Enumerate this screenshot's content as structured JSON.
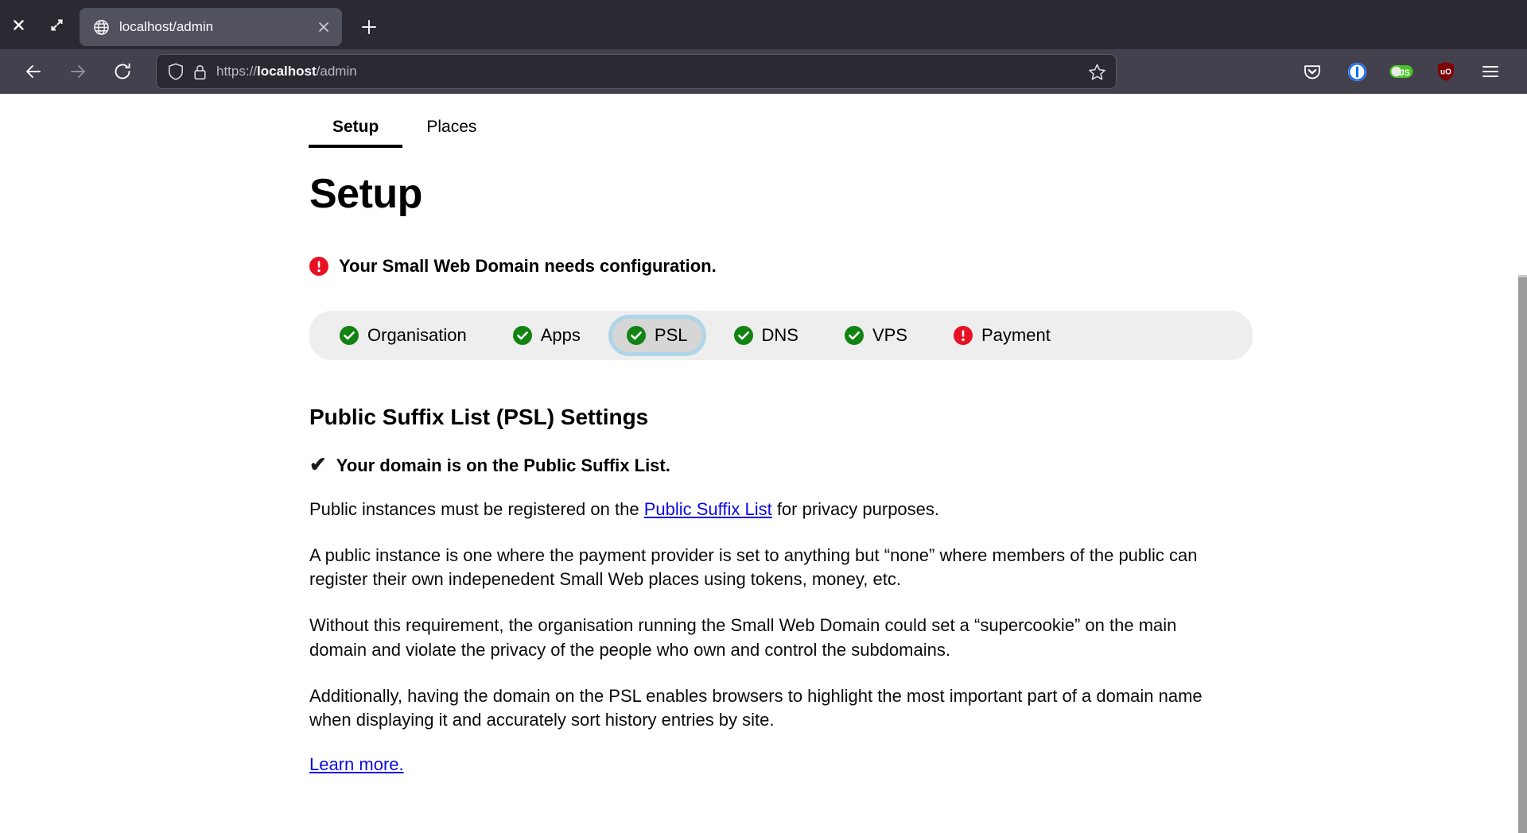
{
  "browser": {
    "window_controls": [
      {
        "name": "close-window-button",
        "icon": "close-icon"
      },
      {
        "name": "restore-window-button",
        "icon": "restore-icon"
      }
    ],
    "tab": {
      "title": "localhost/admin",
      "favicon": "globe-icon",
      "close_icon": "close-icon"
    },
    "new_tab_icon": "plus-icon",
    "nav": {
      "back_icon": "arrow-left-icon",
      "forward_icon": "arrow-right-icon",
      "reload_icon": "reload-icon"
    },
    "urlbar": {
      "shield_icon": "shield-icon",
      "lock_icon": "lock-icon",
      "scheme": "https://",
      "host": "localhost",
      "path": "/admin",
      "full_url": "https://localhost/admin",
      "bookmark_icon": "star-icon"
    },
    "toolbar_extensions": [
      {
        "name": "pocket-icon",
        "label": "Pocket"
      },
      {
        "name": "onepassword-icon",
        "label": "1Password"
      },
      {
        "name": "javascript-toggle-icon",
        "label": "JS"
      },
      {
        "name": "ublock-origin-icon",
        "label": "uO"
      },
      {
        "name": "app-menu-icon",
        "label": "Menu"
      }
    ]
  },
  "page": {
    "tabs": [
      {
        "label": "Setup",
        "active": true
      },
      {
        "label": "Places",
        "active": false
      }
    ],
    "title": "Setup",
    "alert": {
      "icon": "error-icon",
      "text": "Your Small Web Domain needs configuration."
    },
    "steps": [
      {
        "label": "Organisation",
        "status": "ok",
        "current": false
      },
      {
        "label": "Apps",
        "status": "ok",
        "current": false
      },
      {
        "label": "PSL",
        "status": "ok",
        "current": true
      },
      {
        "label": "DNS",
        "status": "ok",
        "current": false
      },
      {
        "label": "VPS",
        "status": "ok",
        "current": false
      },
      {
        "label": "Payment",
        "status": "error",
        "current": false
      }
    ],
    "section": {
      "heading": "Public Suffix List (PSL) Settings",
      "status_check_glyph": "✔",
      "status_text": "Your domain is on the Public Suffix List.",
      "paragraph_1_before": "Public instances must be registered on the ",
      "paragraph_1_link": "Public Suffix List",
      "paragraph_1_after": " for privacy purposes.",
      "paragraph_2": "A public instance is one where the payment provider is set to anything but “none” where members of the public can register their own indepenedent Small Web places using tokens, money, etc.",
      "paragraph_3": "Without this requirement, the organisation running the Small Web Domain could set a “supercookie” on the main domain and violate the privacy of the people who own and control the subdomains.",
      "paragraph_4": "Additionally, having the domain on the PSL enables browsers to highlight the most important part of a domain name when displaying it and accurately sort history entries by site.",
      "learn_more": "Learn more."
    }
  },
  "colors": {
    "chrome_tabstrip": "#2b2a33",
    "chrome_navbar": "#42414d",
    "ok_green": "#128312",
    "error_red": "#e81123",
    "link_blue": "#0a0ae0",
    "focus_ring": "#aed6e8",
    "step_bar": "#eeeeee",
    "step_current": "#d6d6d6"
  }
}
